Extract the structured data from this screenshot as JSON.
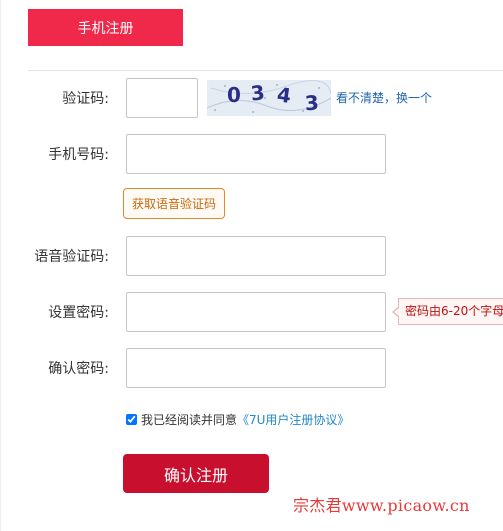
{
  "tab": {
    "label": "手机注册"
  },
  "form": {
    "captcha_label": "验证码:",
    "captcha_text": "0343",
    "captcha_refresh": "看不清楚，换一个",
    "phone_label": "手机号码:",
    "voice_button": "获取语音验证码",
    "voice_code_label": "语音验证码:",
    "password_label": "设置密码:",
    "password_hint": "密码由6-20个字母",
    "confirm_label": "确认密码:"
  },
  "agreement": {
    "checked": true,
    "text": "我已经阅读并同意",
    "link": "《7U用户注册协议》"
  },
  "submit_label": "确认注册",
  "watermark": "宗杰君www.picaow.cn"
}
